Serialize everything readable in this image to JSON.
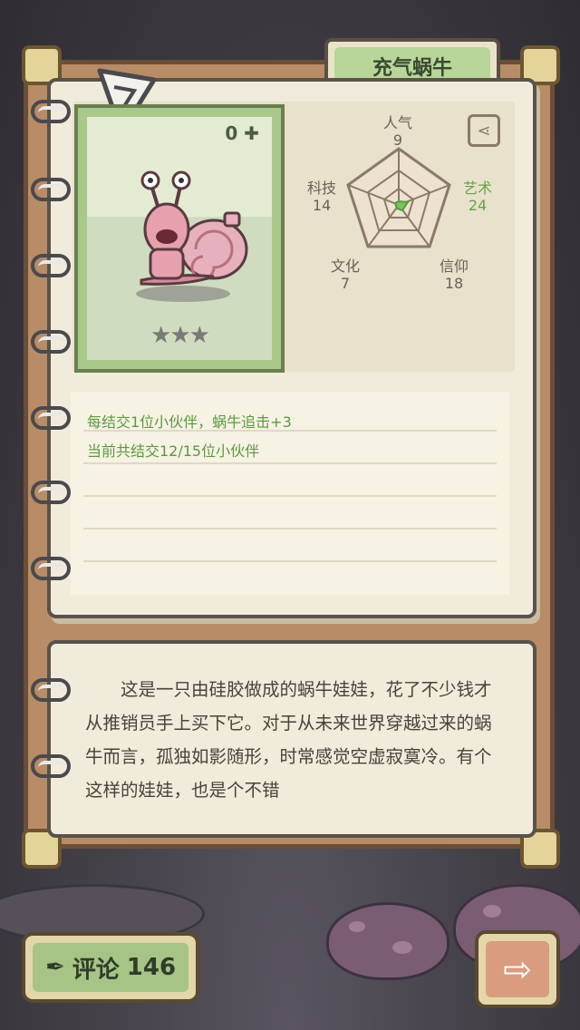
{
  "creature": {
    "name": "充气蜗牛",
    "owned_count": "0",
    "stars": "★★★"
  },
  "stats": {
    "popularity": {
      "label": "人气",
      "value": "9"
    },
    "art": {
      "label": "艺术",
      "value": "24"
    },
    "belief": {
      "label": "信仰",
      "value": "18"
    },
    "culture": {
      "label": "文化",
      "value": "7"
    },
    "tech": {
      "label": "科技",
      "value": "14"
    }
  },
  "ability": {
    "line1": "每结交1位小伙伴，蜗牛追击+3",
    "line2": "当前共结交12/15位小伙伴"
  },
  "lore": "这是一只由硅胶做成的蜗牛娃娃，花了不少钱才从推销员手上买下它。对于从未来世界穿越过来的蜗牛而言，孤独如影随形，时常感觉空虚寂寞冷。有个这样的娃娃，也是个不错",
  "buttons": {
    "comment_label": "评论",
    "comment_count": "146"
  },
  "colors": {
    "card_green": "#a9c98a",
    "text_green": "#5e9940",
    "binder_brown": "#b78c66"
  }
}
